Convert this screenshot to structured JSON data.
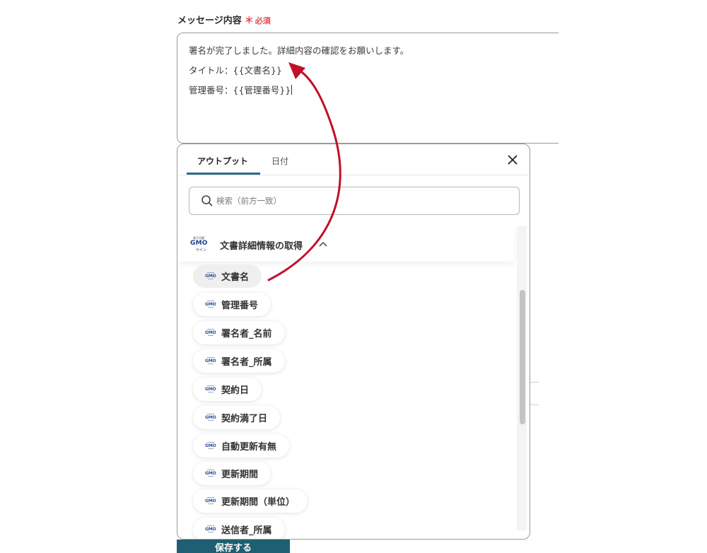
{
  "field": {
    "label": "メッセージ内容",
    "required_star": "＊",
    "required_text": "必須"
  },
  "message": {
    "lines": [
      "署名が完了しました。詳細内容の確認をお願いします。",
      "タイトル：{{文書名}}",
      "管理番号：{{管理番号}}"
    ]
  },
  "panel": {
    "tabs": [
      {
        "label": "アウトプット",
        "active": true
      },
      {
        "label": "日付",
        "active": false
      }
    ],
    "close_icon": "close-icon",
    "search": {
      "placeholder": "検索（前方一致）",
      "value": ""
    },
    "group": {
      "logo_top": "電子印鑑",
      "logo_mid": "GMO",
      "logo_bot": "サイン",
      "title": "文書詳細情報の取得",
      "expanded": true
    },
    "items": [
      {
        "label": "文書名",
        "selected": true
      },
      {
        "label": "管理番号",
        "selected": false
      },
      {
        "label": "署名者_名前",
        "selected": false
      },
      {
        "label": "署名者_所属",
        "selected": false
      },
      {
        "label": "契約日",
        "selected": false
      },
      {
        "label": "契約満了日",
        "selected": false
      },
      {
        "label": "自動更新有無",
        "selected": false
      },
      {
        "label": "更新期間",
        "selected": false
      },
      {
        "label": "更新期間（単位）",
        "selected": false
      },
      {
        "label": "送信者_所属",
        "selected": false
      }
    ]
  },
  "footer": {
    "save_label": "保存する"
  },
  "colors": {
    "accent": "#2f6b87",
    "required": "#e5484d",
    "arrow": "#c0102a",
    "save_button": "#1f5f74"
  }
}
